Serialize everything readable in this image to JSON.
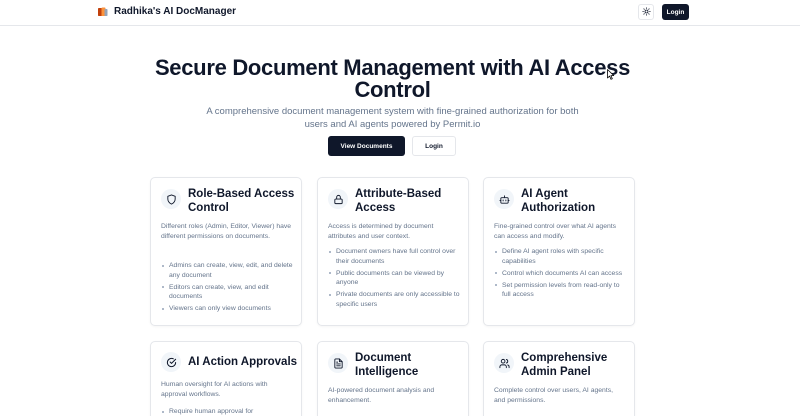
{
  "navbar": {
    "brand_title": "Radhika's AI DocManager",
    "login_label": "Login"
  },
  "hero": {
    "title": "Secure Document Management with AI Access Control",
    "subtitle": "A comprehensive document management system with fine-grained authorization for both users and AI agents powered by Permit.io",
    "view_documents_label": "View Documents",
    "login_label": "Login"
  },
  "features": [
    {
      "icon": "shield-icon",
      "title": "Role-Based Access Control",
      "description": "Different roles (Admin, Editor, Viewer) have different permissions on documents.",
      "bullets": [
        "Admins can create, view, edit, and delete any document",
        "Editors can create, view, and edit documents",
        "Viewers can only view documents"
      ]
    },
    {
      "icon": "lock-icon",
      "title": "Attribute-Based Access",
      "description": "Access is determined by document attributes and user context.",
      "bullets": [
        "Document owners have full control over their documents",
        "Public documents can be viewed by anyone",
        "Private documents are only accessible to specific users"
      ]
    },
    {
      "icon": "bot-icon",
      "title": "AI Agent Authorization",
      "description": "Fine-grained control over what AI agents can access and modify.",
      "bullets": [
        "Define AI agent roles with specific capabilities",
        "Control which documents AI can access",
        "Set permission levels from read-only to full access"
      ]
    },
    {
      "icon": "check-circle-icon",
      "title": "AI Action Approvals",
      "description": "Human oversight for AI actions with approval workflows.",
      "bullets": [
        "Require human approval for"
      ]
    },
    {
      "icon": "file-text-icon",
      "title": "Document Intelligence",
      "description": "AI-powered document analysis and enhancement.",
      "bullets": []
    },
    {
      "icon": "users-icon",
      "title": "Comprehensive Admin Panel",
      "description": "Complete control over users, AI agents, and permissions.",
      "bullets": []
    }
  ]
}
